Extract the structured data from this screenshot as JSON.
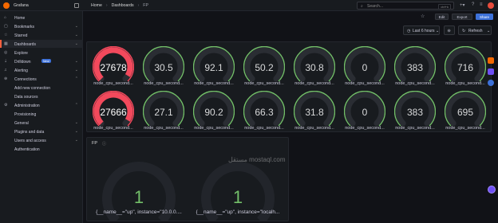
{
  "app": {
    "brand": "Grafana"
  },
  "breadcrumbs": [
    "Home",
    "Dashboards",
    "FP"
  ],
  "search": {
    "placeholder": "Search...",
    "shortcut": "ctrl+k"
  },
  "topbar_icons": [
    "plus-icon",
    "help-icon",
    "news-icon",
    "avatar"
  ],
  "sidebar": {
    "items": [
      {
        "label": "Home",
        "icon": "home-icon",
        "chevron": false,
        "active": false
      },
      {
        "label": "Bookmarks",
        "icon": "bookmark-icon",
        "chevron": true,
        "active": false
      },
      {
        "label": "Starred",
        "icon": "star-icon",
        "chevron": true,
        "active": false
      },
      {
        "label": "Dashboards",
        "icon": "dashboards-icon",
        "chevron": true,
        "active": true
      },
      {
        "label": "Explore",
        "icon": "compass-icon",
        "chevron": false,
        "active": false
      },
      {
        "label": "Drilldown",
        "icon": "drilldown-icon",
        "chevron": true,
        "active": false,
        "badge": "New!"
      },
      {
        "label": "Alerting",
        "icon": "bell-icon",
        "chevron": true,
        "active": false
      },
      {
        "label": "Connections",
        "icon": "plug-icon",
        "chevron": true,
        "active": false
      },
      {
        "label": "Add new connection",
        "sub": true
      },
      {
        "label": "Data sources",
        "sub": true
      },
      {
        "label": "Administration",
        "icon": "gear-icon",
        "chevron": true,
        "active": false
      },
      {
        "label": "Provisioning",
        "sub": true
      },
      {
        "label": "General",
        "sub": true,
        "chevron": true
      },
      {
        "label": "Plugins and data",
        "sub": true,
        "chevron": true
      },
      {
        "label": "Users and access",
        "sub": true,
        "chevron": true
      },
      {
        "label": "Authentication",
        "sub": true
      }
    ]
  },
  "toolbar": {
    "edit": "Edit",
    "export": "Export",
    "share": "Share"
  },
  "time_range": {
    "label": "Last 6 hours",
    "refresh": "Refresh"
  },
  "gauges": {
    "row1": [
      {
        "value": "27678",
        "label": "node_cpu_second...",
        "level": 0.95,
        "color": "#f2495c"
      },
      {
        "value": "30.5",
        "label": "node_cpu_second...",
        "level": 0.0,
        "color": "#73bf69"
      },
      {
        "value": "92.1",
        "label": "node_cpu_second...",
        "level": 0.0,
        "color": "#73bf69"
      },
      {
        "value": "50.2",
        "label": "node_cpu_second...",
        "level": 0.0,
        "color": "#73bf69"
      },
      {
        "value": "30.8",
        "label": "node_cpu_second...",
        "level": 0.0,
        "color": "#73bf69"
      },
      {
        "value": "0",
        "label": "node_cpu_second...",
        "level": 0.0,
        "color": "#73bf69"
      },
      {
        "value": "383",
        "label": "node_cpu_second...",
        "level": 0.0,
        "color": "#73bf69"
      },
      {
        "value": "716",
        "label": "node_cpu_second...",
        "level": 0.0,
        "color": "#73bf69"
      }
    ],
    "row2": [
      {
        "value": "27666",
        "label": "node_cpu_second...",
        "level": 0.95,
        "color": "#f2495c"
      },
      {
        "value": "27.1",
        "label": "node_cpu_second...",
        "level": 0.0,
        "color": "#73bf69"
      },
      {
        "value": "90.2",
        "label": "node_cpu_second...",
        "level": 0.0,
        "color": "#73bf69"
      },
      {
        "value": "66.3",
        "label": "node_cpu_second...",
        "level": 0.0,
        "color": "#73bf69"
      },
      {
        "value": "31.8",
        "label": "node_cpu_second...",
        "level": 0.0,
        "color": "#73bf69"
      },
      {
        "value": "0",
        "label": "node_cpu_second...",
        "level": 0.0,
        "color": "#73bf69"
      },
      {
        "value": "383",
        "label": "node_cpu_second...",
        "level": 0.0,
        "color": "#73bf69"
      },
      {
        "value": "695",
        "label": "node_cpu_second...",
        "level": 0.0,
        "color": "#73bf69"
      }
    ]
  },
  "up_panel": {
    "title": "FP",
    "gauges": [
      {
        "value": "1",
        "label": "{__name__=\"up\", instance=\"10.0.0...."
      },
      {
        "value": "1",
        "label": "{__name__=\"up\", instance=\"localh..."
      }
    ]
  },
  "watermark": "مستقل mostaql.com",
  "colors": {
    "accent": "#f55f3e",
    "primary": "#3d71d9",
    "ok": "#73bf69",
    "bad": "#f2495c"
  }
}
